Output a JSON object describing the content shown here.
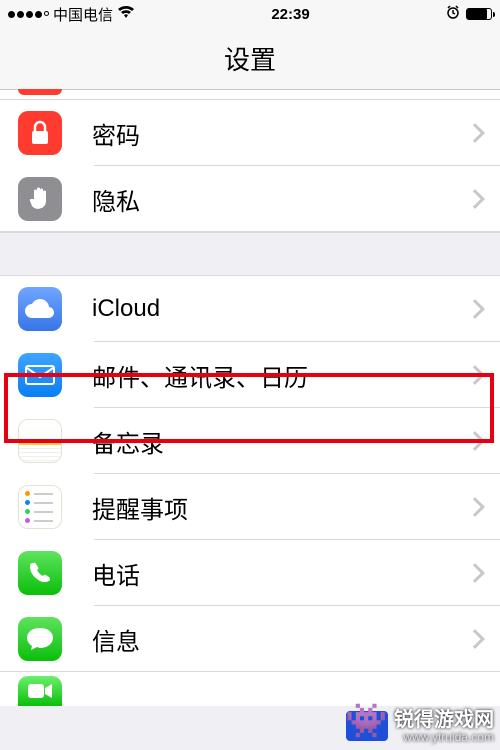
{
  "status": {
    "carrier": "中国电信",
    "time": "22:39"
  },
  "title": "设置",
  "rows": {
    "password": "密码",
    "privacy": "隐私",
    "icloud": "iCloud",
    "mail": "邮件、通讯录、日历",
    "notes": "备忘录",
    "reminders": "提醒事项",
    "phone": "电话",
    "messages": "信息"
  },
  "watermark": {
    "line1": "锐得游戏网",
    "line2": "www.ytruida.com"
  }
}
